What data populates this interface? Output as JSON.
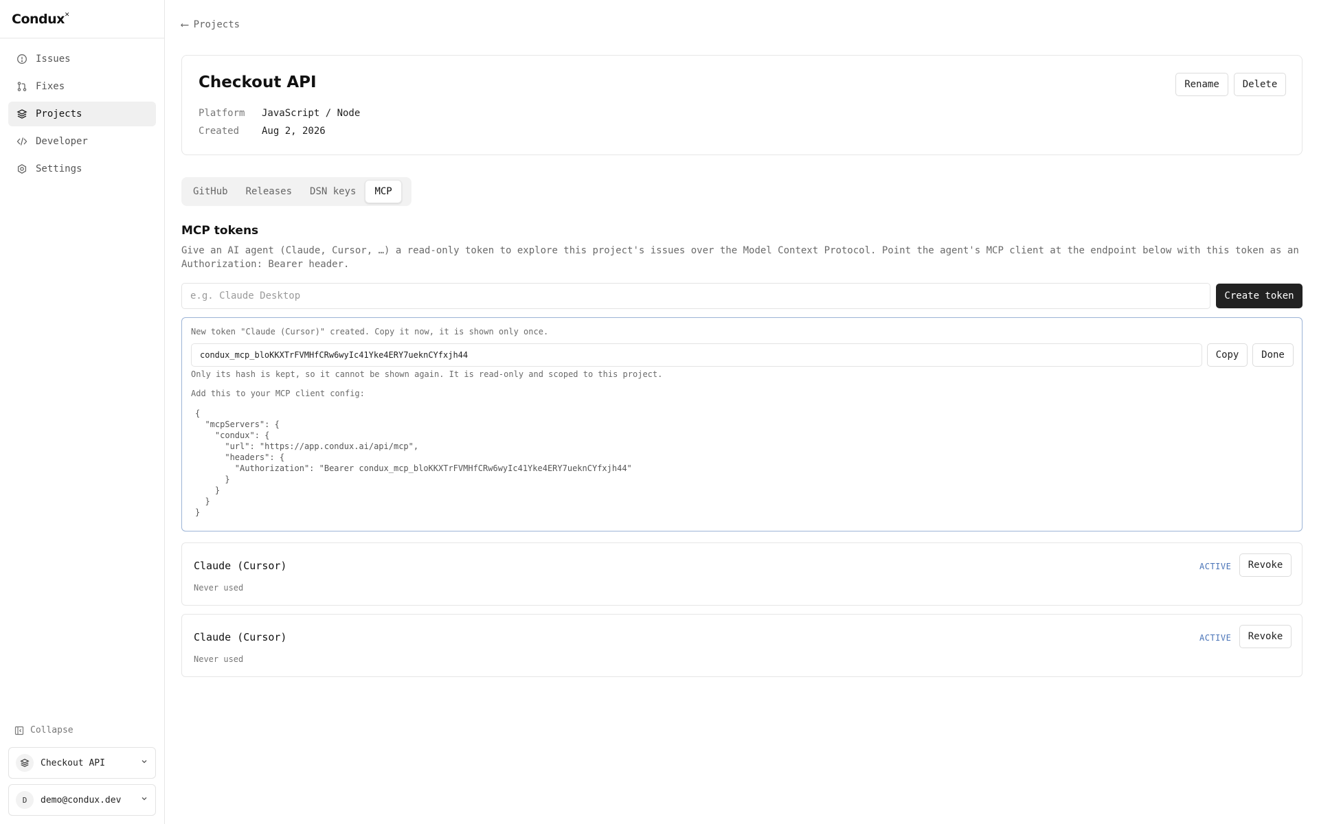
{
  "app": {
    "logo": "Condux"
  },
  "sidebar": {
    "items": [
      {
        "label": "Issues",
        "icon": "alert-circle-icon"
      },
      {
        "label": "Fixes",
        "icon": "git-pull-request-icon"
      },
      {
        "label": "Projects",
        "icon": "layers-icon",
        "active": true
      },
      {
        "label": "Developer",
        "icon": "code-icon"
      },
      {
        "label": "Settings",
        "icon": "gear-icon"
      }
    ],
    "collapse_label": "Collapse",
    "project_switcher": "Checkout API",
    "account": {
      "initial": "D",
      "email": "demo@condux.dev"
    }
  },
  "breadcrumb": {
    "back_label": "Projects"
  },
  "project": {
    "title": "Checkout API",
    "platform_label": "Platform",
    "platform_value": "JavaScript / Node",
    "created_label": "Created",
    "created_value": "Aug 2, 2026",
    "rename_label": "Rename",
    "delete_label": "Delete"
  },
  "tabs": [
    {
      "label": "GitHub"
    },
    {
      "label": "Releases"
    },
    {
      "label": "DSN keys"
    },
    {
      "label": "MCP",
      "active": true
    }
  ],
  "mcp": {
    "title": "MCP tokens",
    "description": "Give an AI agent (Claude, Cursor, …) a read-only token to explore this project's issues over the Model Context Protocol. Point the agent's MCP client at the endpoint below with this token as an Authorization: Bearer header.",
    "input_placeholder": "e.g. Claude Desktop",
    "create_label": "Create token",
    "new_token": {
      "created_note": "New token \"Claude (Cursor)\" created. Copy it now, it is shown only once.",
      "token_value": "condux_mcp_bloKKXTrFVMHfCRw6wyIc41Yke4ERY7ueknCYfxjh44",
      "copy_label": "Copy",
      "done_label": "Done",
      "hash_note": "Only its hash is kept, so it cannot be shown again. It is read-only and scoped to this project.",
      "config_note": "Add this to your MCP client config:",
      "config_code": "{\n  \"mcpServers\": {\n    \"condux\": {\n      \"url\": \"https://app.condux.ai/api/mcp\",\n      \"headers\": {\n        \"Authorization\": \"Bearer condux_mcp_bloKKXTrFVMHfCRw6wyIc41Yke4ERY7ueknCYfxjh44\"\n      }\n    }\n  }\n}"
    },
    "tokens": [
      {
        "name": "Claude (Cursor)",
        "usage": "Never used",
        "status": "ACTIVE",
        "revoke_label": "Revoke"
      },
      {
        "name": "Claude (Cursor)",
        "usage": "Never used",
        "status": "ACTIVE",
        "revoke_label": "Revoke"
      }
    ]
  },
  "colors": {
    "accent_border": "#9bb3d6",
    "status_active": "#4a74b8",
    "primary_button": "#222222"
  }
}
